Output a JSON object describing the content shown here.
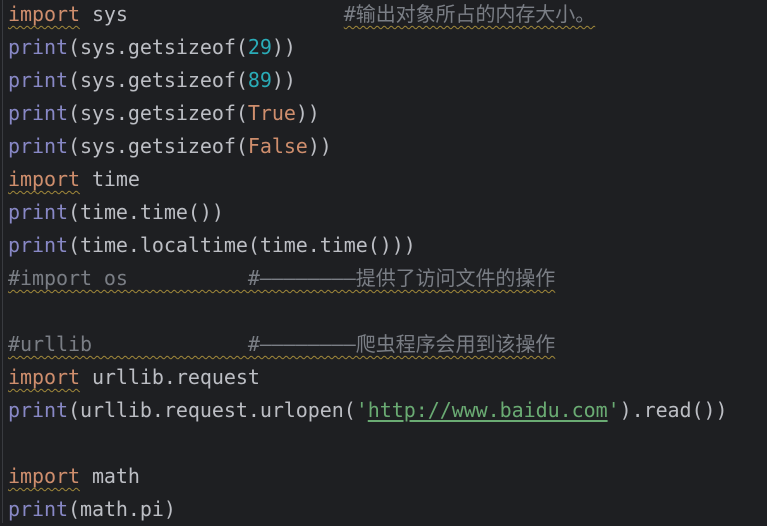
{
  "editor": {
    "language": "python",
    "colors": {
      "background": "#1e1f22",
      "text": "#bcbec4",
      "keyword": "#cf8e6d",
      "builtin": "#8888c6",
      "number": "#2aacb8",
      "string": "#6aab73",
      "comment": "#7a7e85"
    },
    "lines": [
      [
        {
          "t": "import",
          "k": "kw",
          "w": true
        },
        {
          "t": " sys                  ",
          "k": "tx"
        },
        {
          "t": "#输出对象所占的内存大小。",
          "k": "cm",
          "w": true
        }
      ],
      [
        {
          "t": "print",
          "k": "fn"
        },
        {
          "t": "(sys.getsizeof(",
          "k": "tx"
        },
        {
          "t": "29",
          "k": "num"
        },
        {
          "t": "))",
          "k": "tx"
        }
      ],
      [
        {
          "t": "print",
          "k": "fn"
        },
        {
          "t": "(sys.getsizeof(",
          "k": "tx"
        },
        {
          "t": "89",
          "k": "num"
        },
        {
          "t": "))",
          "k": "tx"
        }
      ],
      [
        {
          "t": "print",
          "k": "fn"
        },
        {
          "t": "(sys.getsizeof(",
          "k": "tx"
        },
        {
          "t": "True",
          "k": "kw"
        },
        {
          "t": "))",
          "k": "tx"
        }
      ],
      [
        {
          "t": "print",
          "k": "fn"
        },
        {
          "t": "(sys.getsizeof(",
          "k": "tx"
        },
        {
          "t": "False",
          "k": "kw"
        },
        {
          "t": "))",
          "k": "tx"
        }
      ],
      [
        {
          "t": "import",
          "k": "kw",
          "w": true
        },
        {
          "t": " time",
          "k": "tx"
        }
      ],
      [
        {
          "t": "print",
          "k": "fn"
        },
        {
          "t": "(time.time())",
          "k": "tx"
        }
      ],
      [
        {
          "t": "print",
          "k": "fn"
        },
        {
          "t": "(time.localtime(time.time()))",
          "k": "tx"
        }
      ],
      [
        {
          "t": "#import os          #————————提供了访问文件的操作",
          "k": "cm",
          "w": true
        }
      ],
      [],
      [
        {
          "t": "#urllib             #————————爬虫程序会用到该操作",
          "k": "cm",
          "w": true
        }
      ],
      [
        {
          "t": "import",
          "k": "kw",
          "w": true
        },
        {
          "t": " urllib.request",
          "k": "tx"
        }
      ],
      [
        {
          "t": "print",
          "k": "fn"
        },
        {
          "t": "(urllib.request.urlopen(",
          "k": "tx"
        },
        {
          "t": "'",
          "k": "str"
        },
        {
          "t": "http://www.baidu.com",
          "k": "url"
        },
        {
          "t": "'",
          "k": "str"
        },
        {
          "t": ").read())",
          "k": "tx"
        }
      ],
      [],
      [
        {
          "t": "import",
          "k": "kw",
          "w": true
        },
        {
          "t": " math",
          "k": "tx"
        }
      ],
      [
        {
          "t": "print",
          "k": "fn"
        },
        {
          "t": "(math.pi)",
          "k": "tx"
        }
      ]
    ]
  }
}
